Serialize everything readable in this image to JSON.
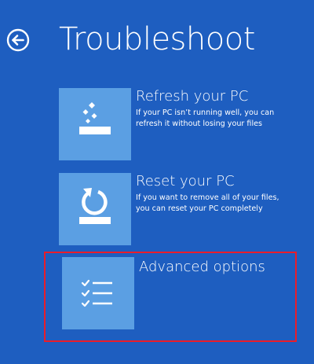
{
  "header": {
    "title": "Troubleshoot",
    "back_icon": "back-arrow-circle-icon"
  },
  "options": [
    {
      "title": "Refresh your PC",
      "description_line1": "If your PC isn’t running well, you can",
      "description_line2": "refresh it without losing your files",
      "icon": "refresh-pc-icon"
    },
    {
      "title": "Reset your PC",
      "description_line1": "If you want to remove all of your files,",
      "description_line2": "you can reset your PC completely",
      "icon": "reset-pc-icon"
    },
    {
      "title": "Advanced options",
      "icon": "checklist-icon"
    }
  ],
  "colors": {
    "background": "#1e5ec0",
    "tile": "#5b9fe3",
    "text": "#ffffff",
    "highlight": "#ea1d2a"
  }
}
